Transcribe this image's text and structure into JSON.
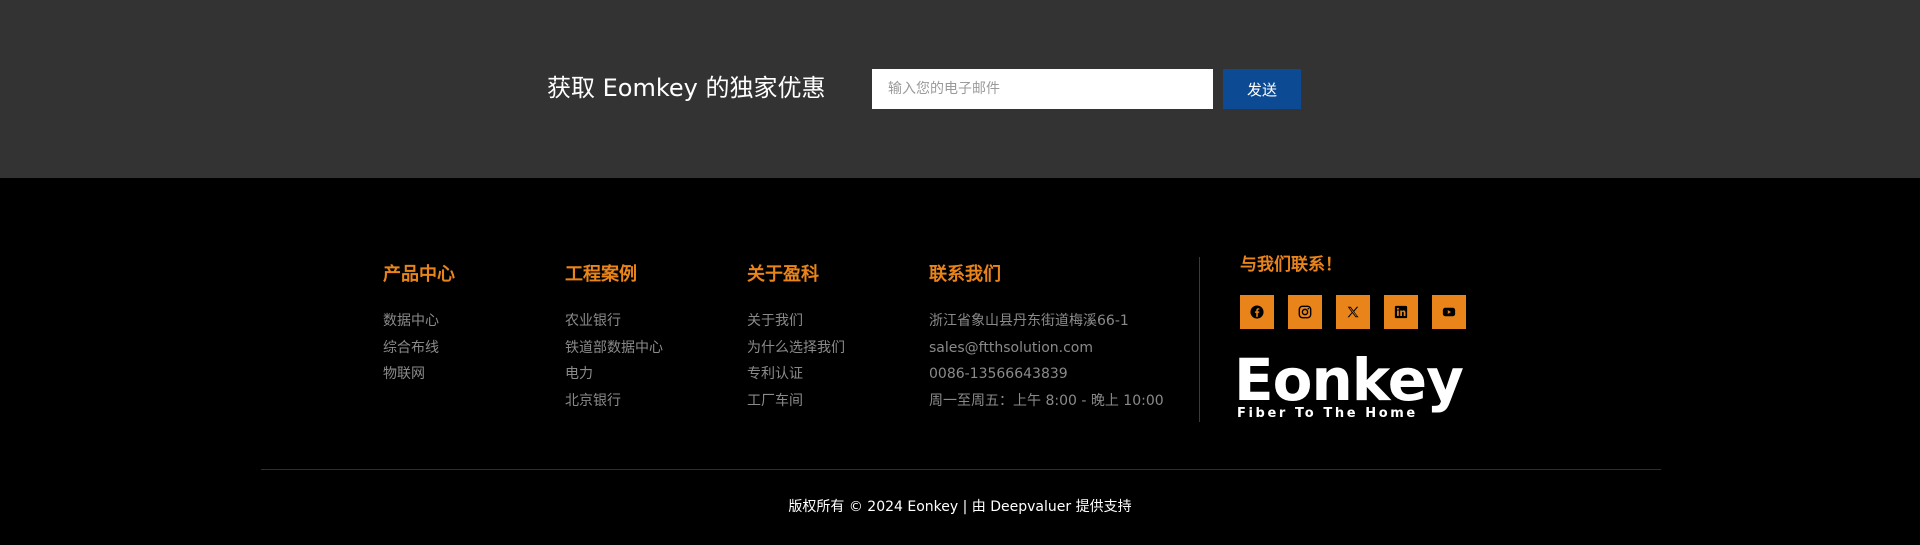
{
  "newsletter": {
    "title": "获取 Eomkey 的独家优惠",
    "email_placeholder": "输入您的电子邮件",
    "send_label": "发送",
    "band_color": "#333333",
    "button_color": "#0d4a94"
  },
  "columns": {
    "products": {
      "heading": "产品中心",
      "items": [
        "数据中心",
        "综合布线",
        "物联网"
      ]
    },
    "cases": {
      "heading": "工程案例",
      "items": [
        "农业银行",
        "铁道部数据中心",
        "电力",
        "北京银行"
      ]
    },
    "about": {
      "heading": "关于盈科",
      "items": [
        "关于我们",
        "为什么选择我们",
        "专利认证",
        "工厂车间"
      ]
    },
    "contact": {
      "heading": "联系我们",
      "items": [
        "浙江省象山县丹东街道梅溪66-1",
        "sales@ftthsolution.com",
        "0086-13566643839",
        "周一至周五：上午 8:00 - 晚上 10:00"
      ]
    }
  },
  "social": {
    "heading": "与我们联系！",
    "icons": [
      "facebook-icon",
      "instagram-icon",
      "x-twitter-icon",
      "linkedin-icon",
      "youtube-icon"
    ],
    "accent_color": "#e8841a"
  },
  "logo": {
    "wordmark": "Eonkey",
    "tagline": "Fiber To The Home"
  },
  "footer": {
    "copyright": "版权所有 © 2024 Eonkey | 由 Deepvaluer 提供支持"
  }
}
